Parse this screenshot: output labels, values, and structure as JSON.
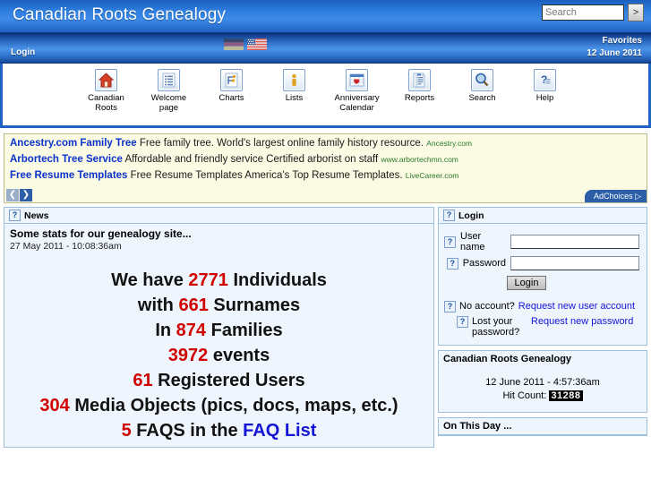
{
  "header": {
    "site_title": "Canadian Roots Genealogy",
    "search_placeholder": "Search",
    "search_value": "",
    "search_go_label": ">"
  },
  "subbar": {
    "login_label": "Login",
    "favorites_label": "Favorites",
    "date_label": "12 June 2011",
    "flags": [
      "german-flag",
      "usa-flag"
    ]
  },
  "toolbar": {
    "items": [
      {
        "label": "Canadian Roots",
        "icon": "home-icon"
      },
      {
        "label": "Welcome page",
        "icon": "list-lines-icon"
      },
      {
        "label": "Charts",
        "icon": "chart-icon"
      },
      {
        "label": "Lists",
        "icon": "person-icon"
      },
      {
        "label": "Anniversary Calendar",
        "icon": "calendar-heart-icon"
      },
      {
        "label": "Reports",
        "icon": "report-document-icon"
      },
      {
        "label": "Search",
        "icon": "magnifier-icon"
      },
      {
        "label": "Help",
        "icon": "question-mark-icon"
      }
    ]
  },
  "ads": {
    "rows": [
      {
        "title": "Ancestry.com Family Tree",
        "desc": "Free family tree. World's largest online family history resource.",
        "url": "Ancestry.com"
      },
      {
        "title": "Arbortech Tree Service",
        "desc": "Affordable and friendly service Certified arborist on staff",
        "url": "www.arbortechmn.com"
      },
      {
        "title": "Free Resume Templates",
        "desc": "Free Resume Templates America's Top Resume Templates.",
        "url": "LiveCareer.com"
      }
    ],
    "prev_label": "❮",
    "next_label": "❯",
    "adchoices_label": "AdChoices ▷"
  },
  "news": {
    "panel_title": "News",
    "help_icon": "?",
    "article_title": "Some stats for our genealogy site...",
    "article_date": "27 May 2011 - 10:08:36am",
    "stats": {
      "line1_pre": "We have ",
      "individuals_count": "2771",
      "line1_post": " Individuals",
      "line2_pre": "with ",
      "surnames_count": "661",
      "line2_post": " Surnames",
      "line3_pre": "In ",
      "families_count": "874",
      "line3_post": " Families",
      "events_count": "3972",
      "line4_post": " events",
      "users_count": "61",
      "line5_post": " Registered Users",
      "media_count": "304",
      "line6_post": " Media Objects (pics, docs, maps, etc.)",
      "faq_count": "5",
      "line7_mid": " FAQS in the ",
      "faq_link": "FAQ List"
    }
  },
  "login_panel": {
    "panel_title": "Login",
    "help_icon": "?",
    "username_label": "User name",
    "username_value": "",
    "password_label": "Password",
    "password_value": "",
    "login_button": "Login",
    "no_account_label": "No account?",
    "request_account_link": "Request new user account",
    "lost_password_label": "Lost your password?",
    "request_password_link": "Request new password"
  },
  "clock_panel": {
    "title": "Canadian Roots Genealogy",
    "datetime": "12 June 2011 - 4:57:36am",
    "hit_count_label": "Hit Count:",
    "hit_count_value": "31288"
  },
  "on_this_day": {
    "title": "On This Day ..."
  },
  "colors": {
    "header_blue": "#2f7fe0",
    "dark_blue": "#11418f",
    "panel_bg": "#eef5fd",
    "panel_border": "#9dc0e0",
    "ad_bg": "#fbfbe4",
    "stat_red": "#d00000",
    "link_blue": "#1414d6"
  }
}
